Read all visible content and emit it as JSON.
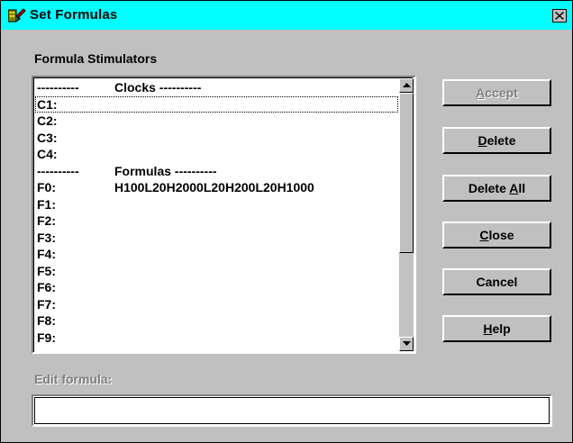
{
  "window": {
    "title": "Set Formulas",
    "icon": "app-wrench-icon",
    "close_glyph": "×"
  },
  "stimulators": {
    "label": "Formula Stimulators",
    "rows": [
      {
        "left": "----------",
        "right": "Clocks ----------",
        "kind": "header"
      },
      {
        "left": "C1:",
        "right": "",
        "kind": "item",
        "selected": true
      },
      {
        "left": "C2:",
        "right": "",
        "kind": "item"
      },
      {
        "left": "C3:",
        "right": "",
        "kind": "item"
      },
      {
        "left": "C4:",
        "right": "",
        "kind": "item"
      },
      {
        "left": "----------",
        "right": "Formulas ----------",
        "kind": "header"
      },
      {
        "left": "F0:",
        "right": "H100L20H2000L20H200L20H1000",
        "kind": "item"
      },
      {
        "left": "F1:",
        "right": "",
        "kind": "item"
      },
      {
        "left": "F2:",
        "right": "",
        "kind": "item"
      },
      {
        "left": "F3:",
        "right": "",
        "kind": "item"
      },
      {
        "left": "F4:",
        "right": "",
        "kind": "item"
      },
      {
        "left": "F5:",
        "right": "",
        "kind": "item"
      },
      {
        "left": "F6:",
        "right": "",
        "kind": "item"
      },
      {
        "left": "F7:",
        "right": "",
        "kind": "item"
      },
      {
        "left": "F8:",
        "right": "",
        "kind": "item"
      },
      {
        "left": "F9:",
        "right": "",
        "kind": "item"
      }
    ]
  },
  "buttons": {
    "accept": "Accept",
    "delete": "Delete",
    "delete_all": "Delete All",
    "close": "Close",
    "cancel": "Cancel",
    "help": "Help"
  },
  "edit": {
    "label": "Edit formula:",
    "value": ""
  },
  "colors": {
    "titlebar": "#00ffff",
    "face": "#c0c0c0",
    "disabled_text": "#808080"
  }
}
